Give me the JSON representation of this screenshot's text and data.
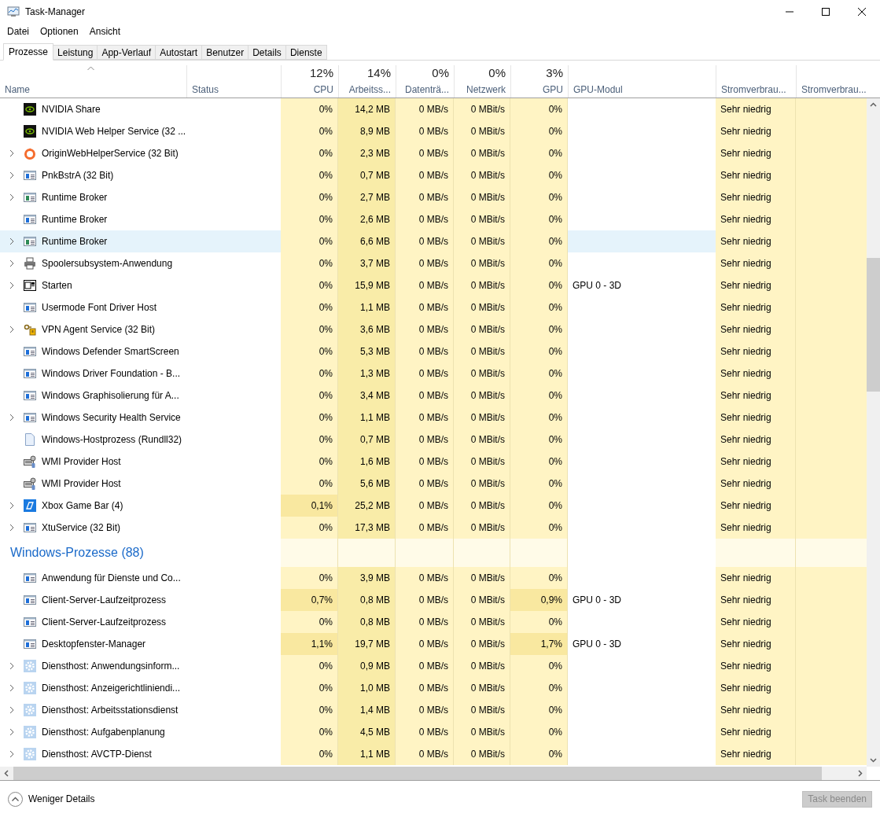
{
  "window": {
    "title": "Task-Manager"
  },
  "menu": [
    "Datei",
    "Optionen",
    "Ansicht"
  ],
  "tabs": [
    {
      "label": "Prozesse",
      "selected": true
    },
    {
      "label": "Leistung",
      "selected": false
    },
    {
      "label": "App-Verlauf",
      "selected": false
    },
    {
      "label": "Autostart",
      "selected": false
    },
    {
      "label": "Benutzer",
      "selected": false
    },
    {
      "label": "Details",
      "selected": false
    },
    {
      "label": "Dienste",
      "selected": false
    }
  ],
  "columns": [
    {
      "label": "Name",
      "sorted": true
    },
    {
      "label": "Status"
    },
    {
      "label": "CPU",
      "usage": "12%"
    },
    {
      "label": "Arbeitss...",
      "usage": "14%"
    },
    {
      "label": "Datenträ...",
      "usage": "0%"
    },
    {
      "label": "Netzwerk",
      "usage": "0%"
    },
    {
      "label": "GPU",
      "usage": "3%"
    },
    {
      "label": "GPU-Modul"
    },
    {
      "label": "Stromverbrau..."
    },
    {
      "label": "Stromverbrau..."
    }
  ],
  "rows": [
    {
      "kind": "process",
      "name": "NVIDIA Share",
      "expandable": false,
      "selected": false,
      "cpu": "0%",
      "mem": "14,2 MB",
      "disk": "0 MB/s",
      "net": "0 MBit/s",
      "gpu": "0%",
      "power": "Sehr niedrig",
      "cpu_hot": false,
      "gpu_hot": false
    },
    {
      "kind": "process",
      "name": "NVIDIA Web Helper Service (32 ...",
      "expandable": false,
      "selected": false,
      "cpu": "0%",
      "mem": "8,9 MB",
      "disk": "0 MB/s",
      "net": "0 MBit/s",
      "gpu": "0%",
      "power": "Sehr niedrig",
      "cpu_hot": false,
      "gpu_hot": false
    },
    {
      "kind": "process",
      "name": "OriginWebHelperService (32 Bit)",
      "expandable": true,
      "selected": false,
      "cpu": "0%",
      "mem": "2,3 MB",
      "disk": "0 MB/s",
      "net": "0 MBit/s",
      "gpu": "0%",
      "power": "Sehr niedrig",
      "cpu_hot": false,
      "gpu_hot": false
    },
    {
      "kind": "process",
      "name": "PnkBstrA (32 Bit)",
      "expandable": true,
      "selected": false,
      "cpu": "0%",
      "mem": "0,7 MB",
      "disk": "0 MB/s",
      "net": "0 MBit/s",
      "gpu": "0%",
      "power": "Sehr niedrig",
      "cpu_hot": false,
      "gpu_hot": false
    },
    {
      "kind": "process",
      "name": "Runtime Broker",
      "expandable": true,
      "selected": false,
      "cpu": "0%",
      "mem": "2,7 MB",
      "disk": "0 MB/s",
      "net": "0 MBit/s",
      "gpu": "0%",
      "power": "Sehr niedrig",
      "cpu_hot": false,
      "gpu_hot": false
    },
    {
      "kind": "process",
      "name": "Runtime Broker",
      "expandable": false,
      "selected": false,
      "cpu": "0%",
      "mem": "2,6 MB",
      "disk": "0 MB/s",
      "net": "0 MBit/s",
      "gpu": "0%",
      "power": "Sehr niedrig",
      "cpu_hot": false,
      "gpu_hot": false
    },
    {
      "kind": "process",
      "name": "Runtime Broker",
      "expandable": true,
      "selected": true,
      "cpu": "0%",
      "mem": "6,6 MB",
      "disk": "0 MB/s",
      "net": "0 MBit/s",
      "gpu": "0%",
      "power": "Sehr niedrig",
      "cpu_hot": false,
      "gpu_hot": false
    },
    {
      "kind": "process",
      "name": "Spoolersubsystem-Anwendung",
      "expandable": true,
      "selected": false,
      "cpu": "0%",
      "mem": "3,7 MB",
      "disk": "0 MB/s",
      "net": "0 MBit/s",
      "gpu": "0%",
      "power": "Sehr niedrig",
      "cpu_hot": false,
      "gpu_hot": false
    },
    {
      "kind": "process",
      "name": "Starten",
      "expandable": true,
      "selected": false,
      "cpu": "0%",
      "mem": "15,9 MB",
      "disk": "0 MB/s",
      "net": "0 MBit/s",
      "gpu": "0%",
      "gpu_engine": "GPU 0 - 3D",
      "power": "Sehr niedrig",
      "cpu_hot": false,
      "gpu_hot": false
    },
    {
      "kind": "process",
      "name": "Usermode Font Driver Host",
      "expandable": false,
      "selected": false,
      "cpu": "0%",
      "mem": "1,1 MB",
      "disk": "0 MB/s",
      "net": "0 MBit/s",
      "gpu": "0%",
      "power": "Sehr niedrig",
      "cpu_hot": false,
      "gpu_hot": false
    },
    {
      "kind": "process",
      "name": "VPN Agent Service (32 Bit)",
      "expandable": true,
      "selected": false,
      "cpu": "0%",
      "mem": "3,6 MB",
      "disk": "0 MB/s",
      "net": "0 MBit/s",
      "gpu": "0%",
      "power": "Sehr niedrig",
      "cpu_hot": false,
      "gpu_hot": false
    },
    {
      "kind": "process",
      "name": "Windows Defender SmartScreen",
      "expandable": false,
      "selected": false,
      "cpu": "0%",
      "mem": "5,3 MB",
      "disk": "0 MB/s",
      "net": "0 MBit/s",
      "gpu": "0%",
      "power": "Sehr niedrig",
      "cpu_hot": false,
      "gpu_hot": false
    },
    {
      "kind": "process",
      "name": "Windows Driver Foundation - B...",
      "expandable": false,
      "selected": false,
      "cpu": "0%",
      "mem": "1,3 MB",
      "disk": "0 MB/s",
      "net": "0 MBit/s",
      "gpu": "0%",
      "power": "Sehr niedrig",
      "cpu_hot": false,
      "gpu_hot": false
    },
    {
      "kind": "process",
      "name": "Windows Graphisolierung für A...",
      "expandable": false,
      "selected": false,
      "cpu": "0%",
      "mem": "3,4 MB",
      "disk": "0 MB/s",
      "net": "0 MBit/s",
      "gpu": "0%",
      "power": "Sehr niedrig",
      "cpu_hot": false,
      "gpu_hot": false
    },
    {
      "kind": "process",
      "name": "Windows Security Health Service",
      "expandable": true,
      "selected": false,
      "cpu": "0%",
      "mem": "1,1 MB",
      "disk": "0 MB/s",
      "net": "0 MBit/s",
      "gpu": "0%",
      "power": "Sehr niedrig",
      "cpu_hot": false,
      "gpu_hot": false
    },
    {
      "kind": "process",
      "name": "Windows-Hostprozess (Rundll32)",
      "expandable": false,
      "selected": false,
      "cpu": "0%",
      "mem": "0,7 MB",
      "disk": "0 MB/s",
      "net": "0 MBit/s",
      "gpu": "0%",
      "power": "Sehr niedrig",
      "cpu_hot": false,
      "gpu_hot": false
    },
    {
      "kind": "process",
      "name": "WMI Provider Host",
      "expandable": false,
      "selected": false,
      "cpu": "0%",
      "mem": "1,6 MB",
      "disk": "0 MB/s",
      "net": "0 MBit/s",
      "gpu": "0%",
      "power": "Sehr niedrig",
      "cpu_hot": false,
      "gpu_hot": false
    },
    {
      "kind": "process",
      "name": "WMI Provider Host",
      "expandable": false,
      "selected": false,
      "cpu": "0%",
      "mem": "5,6 MB",
      "disk": "0 MB/s",
      "net": "0 MBit/s",
      "gpu": "0%",
      "power": "Sehr niedrig",
      "cpu_hot": false,
      "gpu_hot": false
    },
    {
      "kind": "process",
      "name": "Xbox Game Bar (4)",
      "expandable": true,
      "selected": false,
      "cpu": "0,1%",
      "mem": "25,2 MB",
      "disk": "0 MB/s",
      "net": "0 MBit/s",
      "gpu": "0%",
      "power": "Sehr niedrig",
      "cpu_hot": true,
      "gpu_hot": false
    },
    {
      "kind": "process",
      "name": "XtuService (32 Bit)",
      "expandable": true,
      "selected": false,
      "cpu": "0%",
      "mem": "17,3 MB",
      "disk": "0 MB/s",
      "net": "0 MBit/s",
      "gpu": "0%",
      "power": "Sehr niedrig",
      "cpu_hot": false,
      "gpu_hot": false
    },
    {
      "kind": "group",
      "name": "Windows-Prozesse (88)"
    },
    {
      "kind": "process",
      "name": "Anwendung für Dienste und Co...",
      "expandable": false,
      "selected": false,
      "cpu": "0%",
      "mem": "3,9 MB",
      "disk": "0 MB/s",
      "net": "0 MBit/s",
      "gpu": "0%",
      "power": "Sehr niedrig",
      "cpu_hot": false,
      "gpu_hot": false
    },
    {
      "kind": "process",
      "name": "Client-Server-Laufzeitprozess",
      "expandable": false,
      "selected": false,
      "cpu": "0,7%",
      "mem": "0,8 MB",
      "disk": "0 MB/s",
      "net": "0 MBit/s",
      "gpu": "0,9%",
      "gpu_engine": "GPU 0 - 3D",
      "power": "Sehr niedrig",
      "cpu_hot": true,
      "gpu_hot": true
    },
    {
      "kind": "process",
      "name": "Client-Server-Laufzeitprozess",
      "expandable": false,
      "selected": false,
      "cpu": "0%",
      "mem": "0,8 MB",
      "disk": "0 MB/s",
      "net": "0 MBit/s",
      "gpu": "0%",
      "power": "Sehr niedrig",
      "cpu_hot": false,
      "gpu_hot": false
    },
    {
      "kind": "process",
      "name": "Desktopfenster-Manager",
      "expandable": false,
      "selected": false,
      "cpu": "1,1%",
      "mem": "19,7 MB",
      "disk": "0 MB/s",
      "net": "0 MBit/s",
      "gpu": "1,7%",
      "gpu_engine": "GPU 0 - 3D",
      "power": "Sehr niedrig",
      "cpu_hot": true,
      "gpu_hot": true
    },
    {
      "kind": "process",
      "name": "Diensthost: Anwendungsinform...",
      "expandable": true,
      "selected": false,
      "cpu": "0%",
      "mem": "0,9 MB",
      "disk": "0 MB/s",
      "net": "0 MBit/s",
      "gpu": "0%",
      "power": "Sehr niedrig",
      "cpu_hot": false,
      "gpu_hot": false
    },
    {
      "kind": "process",
      "name": "Diensthost: Anzeigerichtliniendi...",
      "expandable": true,
      "selected": false,
      "cpu": "0%",
      "mem": "1,0 MB",
      "disk": "0 MB/s",
      "net": "0 MBit/s",
      "gpu": "0%",
      "power": "Sehr niedrig",
      "cpu_hot": false,
      "gpu_hot": false
    },
    {
      "kind": "process",
      "name": "Diensthost: Arbeitsstationsdienst",
      "expandable": true,
      "selected": false,
      "cpu": "0%",
      "mem": "1,4 MB",
      "disk": "0 MB/s",
      "net": "0 MBit/s",
      "gpu": "0%",
      "power": "Sehr niedrig",
      "cpu_hot": false,
      "gpu_hot": false
    },
    {
      "kind": "process",
      "name": "Diensthost: Aufgabenplanung",
      "expandable": true,
      "selected": false,
      "cpu": "0%",
      "mem": "4,5 MB",
      "disk": "0 MB/s",
      "net": "0 MBit/s",
      "gpu": "0%",
      "power": "Sehr niedrig",
      "cpu_hot": false,
      "gpu_hot": false
    },
    {
      "kind": "process",
      "name": "Diensthost: AVCTP-Dienst",
      "expandable": true,
      "selected": false,
      "cpu": "0%",
      "mem": "1,1 MB",
      "disk": "0 MB/s",
      "net": "0 MBit/s",
      "gpu": "0%",
      "power": "Sehr niedrig",
      "cpu_hot": false,
      "gpu_hot": false
    }
  ],
  "footer": {
    "toggle": "Weniger Details",
    "end_task": {
      "label": "Task beenden",
      "disabled": true
    }
  }
}
